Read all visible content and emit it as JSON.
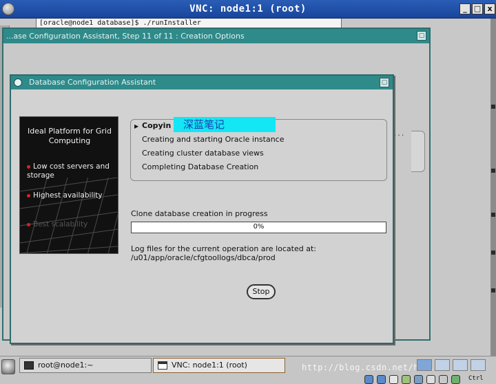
{
  "vnc": {
    "title": "VNC: node1:1 (root)",
    "minimize": "_",
    "maximize": "□",
    "close": "x"
  },
  "terminal": {
    "prompt_line": "[oracle@node1 database]$ ./runInstaller"
  },
  "dbca_window": {
    "title": "...ase Configuration Assistant, Step 11 of 11 : Creation Options"
  },
  "dialog": {
    "title": "Database Configuration Assistant",
    "branding": {
      "title": "Ideal Platform for Grid Computing",
      "bullets": [
        "Low cost servers and storage",
        "Highest availability",
        "Best scalability"
      ]
    },
    "steps": [
      "Copying database files",
      "Creating and starting Oracle instance",
      "Creating cluster database views",
      "Completing Database Creation"
    ],
    "steps_visible_prefix": "Copyin",
    "watermark_label": "深蓝笔记",
    "status": "Clone database creation in progress",
    "progress": {
      "percent": 0,
      "label": "0%"
    },
    "log_label": "Log files for the current operation are located at:",
    "log_path": "/u01/app/oracle/cfgtoollogs/dbca/prod",
    "stop_label": "Stop"
  },
  "taskbar": {
    "items": [
      {
        "label": "root@node1:~"
      },
      {
        "label": "VNC: node1:1 (root)",
        "active": true
      }
    ],
    "url_watermark": "http://blog.csdn.net/hu...",
    "tray_text": "Ctrl"
  },
  "colors": {
    "vnc_title": "#1f4fa7",
    "dialog_title": "#2f8a8a",
    "watermark_bg": "#13e6f4"
  }
}
